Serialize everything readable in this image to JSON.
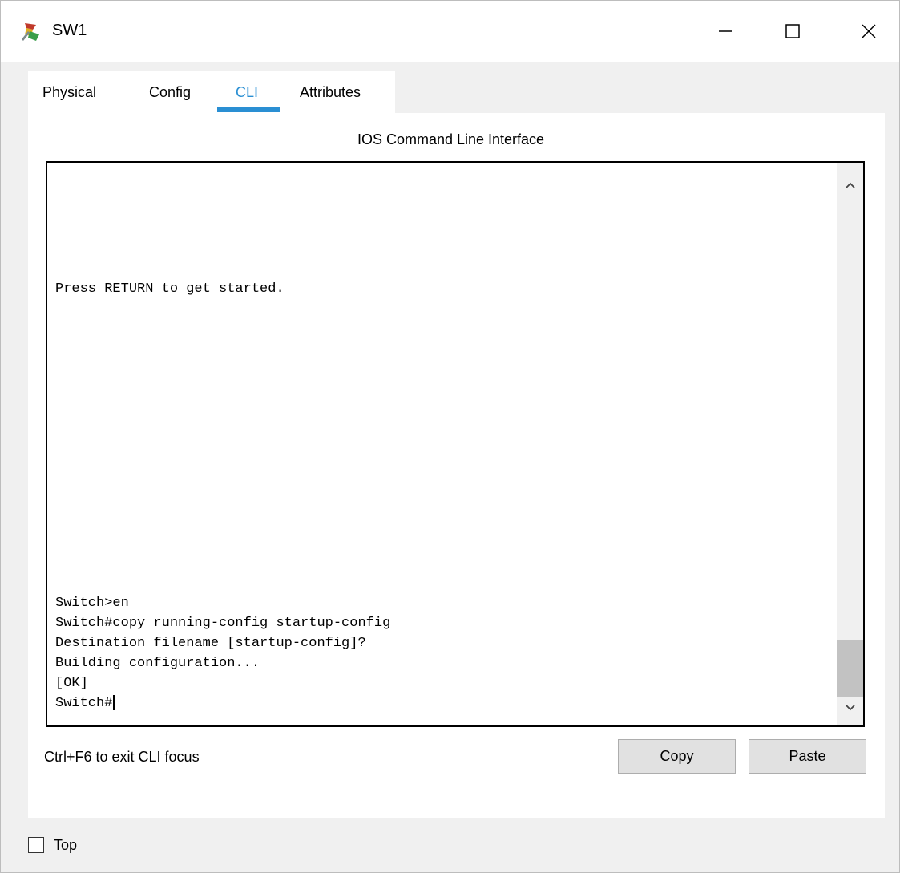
{
  "window": {
    "title": "SW1",
    "icon": "router-switch-app-icon",
    "controls": {
      "minimize": "minimize-icon",
      "maximize": "maximize-icon",
      "close": "close-icon"
    }
  },
  "tabs": [
    {
      "label": "Physical",
      "active": false
    },
    {
      "label": "Config",
      "active": false
    },
    {
      "label": "CLI",
      "active": true
    },
    {
      "label": "Attributes",
      "active": false
    }
  ],
  "panel": {
    "title": "IOS Command Line Interface"
  },
  "terminal": {
    "lines": [
      "Press RETURN to get started.",
      "Switch>en",
      "Switch#copy running-config startup-config",
      "Destination filename [startup-config]?",
      "Building configuration...",
      "[OK]",
      "Switch#"
    ]
  },
  "footer": {
    "hint": "Ctrl+F6 to exit CLI focus",
    "copy_label": "Copy",
    "paste_label": "Paste"
  },
  "bottom": {
    "top_label": "Top",
    "top_checked": false
  },
  "colors": {
    "accent": "#2a8fd3",
    "window_bg": "#f0f0f0",
    "button_bg": "#e1e1e1"
  }
}
